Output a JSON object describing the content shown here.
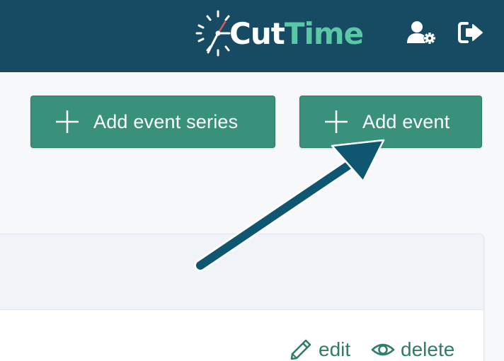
{
  "header": {
    "logo": {
      "part1": "Cut",
      "part2": "Time"
    },
    "icons": [
      "user-settings-icon",
      "logout-icon"
    ]
  },
  "actions": {
    "add_event_series": {
      "label": "Add event series",
      "icon": "plus-icon"
    },
    "add_event": {
      "label": "Add event",
      "icon": "plus-icon"
    }
  },
  "row": {
    "edit_label": "edit",
    "edit_icon": "pencil-icon",
    "delete_label": "delete",
    "delete_icon": "eye-icon"
  },
  "annotation": {
    "icon": "callout-arrow"
  },
  "colors": {
    "header_bg": "#174b63",
    "brand_accent": "#59c9a5",
    "button_bg": "#3a917b",
    "link": "#2d7d68",
    "arrow": "#0f5670"
  }
}
